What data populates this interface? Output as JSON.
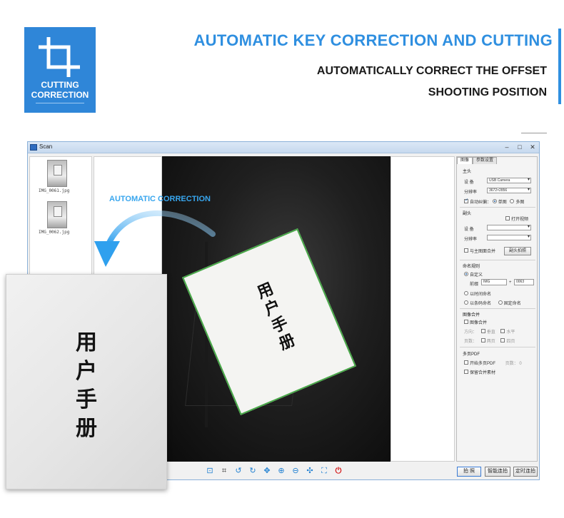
{
  "promo": {
    "badge_line1": "CUTTING",
    "badge_line2": "CORRECTION",
    "headline": "AUTOMATIC KEY CORRECTION AND CUTTING",
    "sub1": "AUTOMATICALLY CORRECT THE OFFSET",
    "sub2": "SHOOTING POSITION",
    "accent_color": "#2f8fe0"
  },
  "window": {
    "title": "Scan",
    "controls": [
      "–",
      "□",
      "✕"
    ],
    "thumbnails": [
      {
        "label": "IMG_0061.jpg"
      },
      {
        "label": "IMG_0062.jpg"
      }
    ],
    "document_text": "用户手册"
  },
  "panel": {
    "tabs": [
      "图像",
      "参数设置"
    ],
    "main_cam": {
      "section": "主头",
      "device_label": "设  备",
      "device_value": "USB Camera",
      "res_label": "分辨率",
      "res_value": "3672×2856",
      "auto_crop": "自动纠偏：",
      "single": "单图",
      "multi": "多图"
    },
    "sub_cam": {
      "section": "副头",
      "open_video": "打开视频",
      "device_label": "设  备",
      "res_label": "分辨率",
      "merge_main": "与主图面合并",
      "sub_capture": "副头拍照"
    },
    "naming": {
      "section": "命名规则",
      "custom": "自定义",
      "prefix_label": "前缀",
      "prefix_value": "IMG",
      "plus": "+",
      "number_value": "0063",
      "by_time": "以时间命名",
      "by_barcode": "以条码命名",
      "fixed_name": "固定命名"
    },
    "merge": {
      "section": "图像合并",
      "merge_image": "图像合并",
      "direction_label": "方向：",
      "vertical": "垂直",
      "horizontal": "水平",
      "pages_label": "页数：",
      "two": "两页",
      "four": "四页"
    },
    "pdf": {
      "section": "多页PDF",
      "start_pdf": "开始多页PDF",
      "pages_label": "页数：",
      "pages_value": "0",
      "keep_material": "保留合并素材"
    }
  },
  "toolbar": {
    "icons": [
      "fit-icon",
      "crop-icon",
      "rotate-left-icon",
      "rotate-right-icon",
      "move-icon",
      "zoom-in-icon",
      "zoom-out-icon",
      "expand-icon",
      "fullscreen-icon",
      "power-icon"
    ],
    "capture": "拍 照",
    "smart_capture": "智能连拍",
    "timed_capture": "定时连拍"
  },
  "overlay": {
    "auto_label": "AUTOMATIC CORRECTION",
    "cropped_text": "用户手册",
    "label_color": "#38a6ee"
  }
}
